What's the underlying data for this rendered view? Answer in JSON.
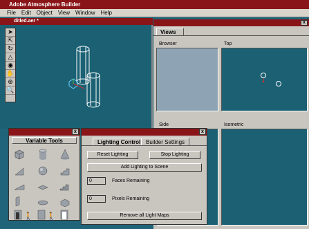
{
  "app": {
    "title": "Adobe Atmosphere Builder"
  },
  "menu": [
    "File",
    "Edit",
    "Object",
    "View",
    "Window",
    "Help"
  ],
  "document": {
    "title": "ditled.aer *"
  },
  "toolbox": {
    "tools": [
      "select-arrow",
      "direct-select-arrow",
      "rotate",
      "shape",
      "fill",
      "hand",
      "zoom",
      "magnify"
    ]
  },
  "views": {
    "tab": "Views",
    "panes": {
      "browser": "Browser",
      "top": "Top",
      "side": "Side",
      "isometric": "Isometric"
    }
  },
  "variable_tools": {
    "label": "Variable Tools",
    "shapes": [
      "cube",
      "cylinder",
      "cone",
      "wedge",
      "sphere",
      "stairs",
      "ramp",
      "slab",
      "steps",
      "wall",
      "disk",
      "box",
      "doorway",
      "door",
      "portal"
    ]
  },
  "lighting": {
    "tabs": [
      "Lighting Control",
      "Builder Settings"
    ],
    "reset_label": "Reset Lighting",
    "stop_label": "Stop Lighting",
    "add_label": "Add Lighting to Scene",
    "faces_value": "0",
    "faces_label": "Faces Remaining",
    "pixels_value": "0",
    "pixels_label": "Pixels Remaining",
    "remove_label": "Remove all Light Maps"
  },
  "colors": {
    "titlebar": "#8a1518",
    "workspace": "#1f6478",
    "panel": "#c9c6c0"
  }
}
